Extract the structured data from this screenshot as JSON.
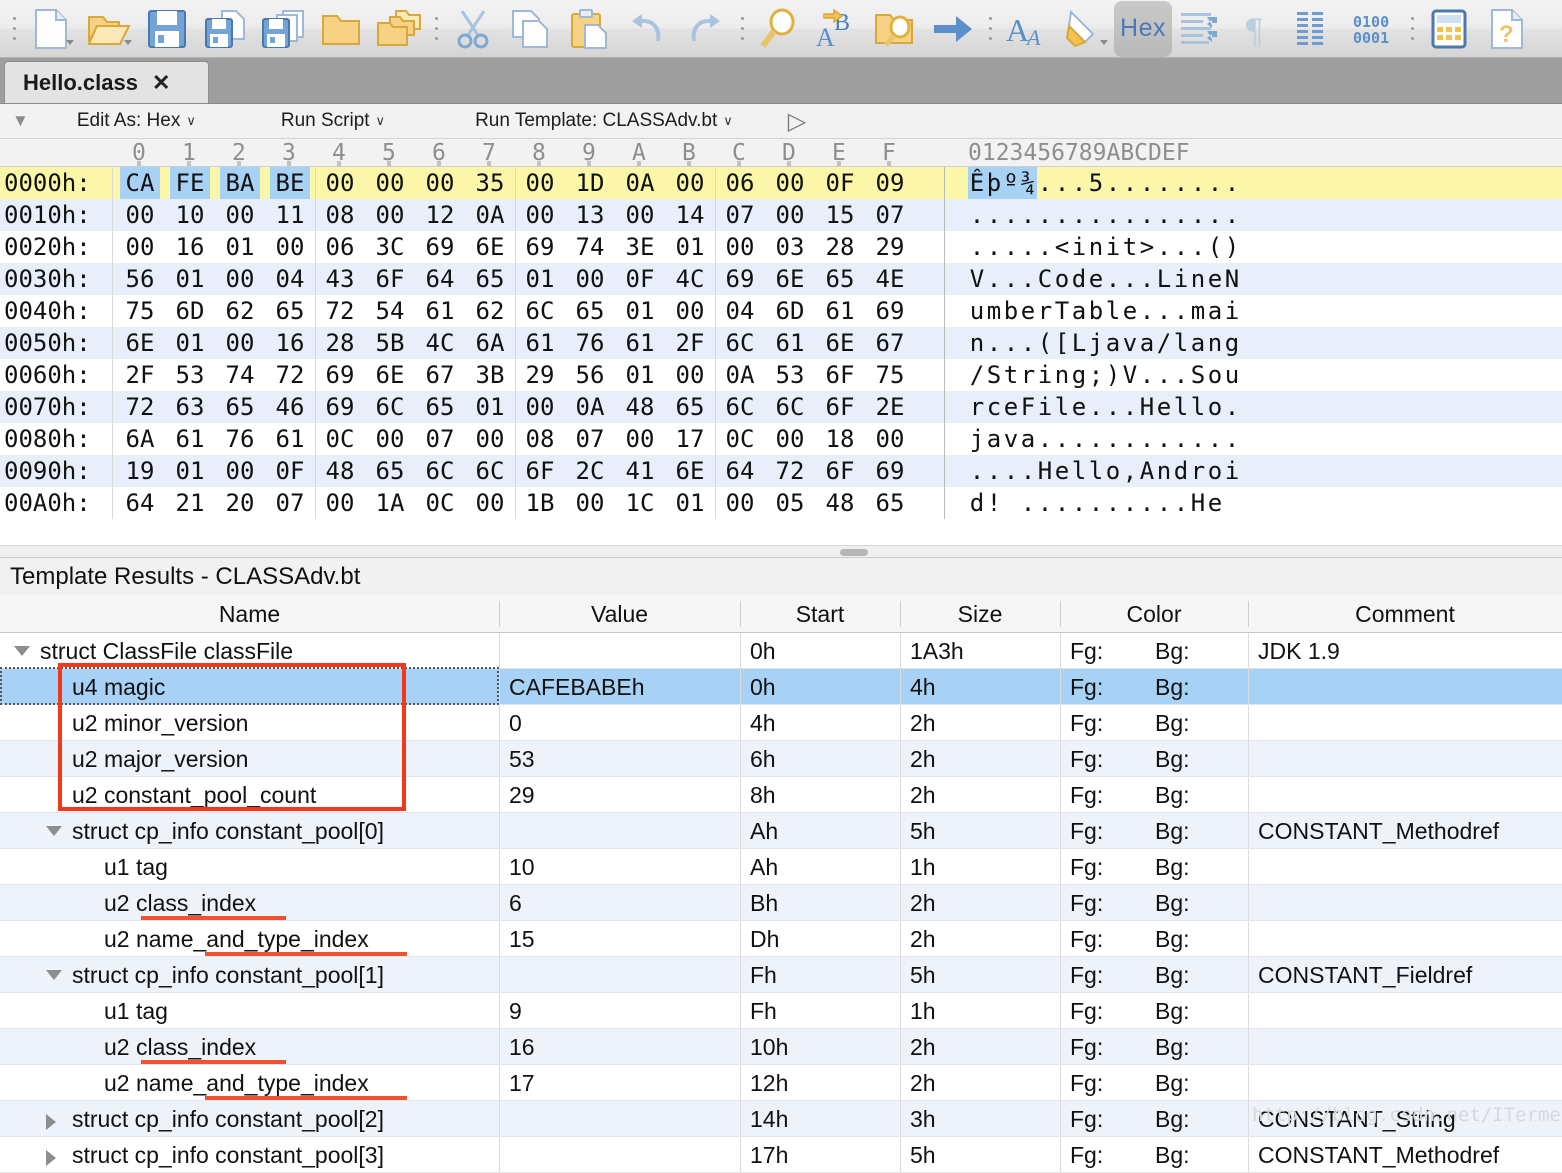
{
  "toolbar": {
    "items": [
      {
        "name": "new-file-icon",
        "label": "New"
      },
      {
        "name": "open-folder-icon",
        "label": "Open"
      },
      {
        "name": "save-icon",
        "label": "Save"
      },
      {
        "name": "save-as-icon",
        "label": "Save As"
      },
      {
        "name": "save-all-icon",
        "label": "Save All"
      },
      {
        "name": "open-directory-icon",
        "label": "Open Directory"
      },
      {
        "name": "save-all-files-icon",
        "label": "Save All Files"
      },
      {
        "name": "cut-icon",
        "label": "Cut"
      },
      {
        "name": "copy-icon",
        "label": "Copy"
      },
      {
        "name": "paste-icon",
        "label": "Paste"
      },
      {
        "name": "undo-icon",
        "label": "Undo"
      },
      {
        "name": "redo-icon",
        "label": "Redo"
      },
      {
        "name": "find-icon",
        "label": "Find"
      },
      {
        "name": "replace-icon",
        "label": "Replace"
      },
      {
        "name": "find-in-files-icon",
        "label": "Find In Files"
      },
      {
        "name": "goto-icon",
        "label": "Goto"
      },
      {
        "name": "font-icon",
        "label": "Font"
      },
      {
        "name": "highlight-icon",
        "label": "Highlight"
      },
      {
        "name": "hex-mode-button",
        "label": "Hex"
      },
      {
        "name": "wrap-lines-icon",
        "label": "Wrap Lines"
      },
      {
        "name": "show-paragraph-icon",
        "label": "Show Paragraph"
      },
      {
        "name": "line-numbers-icon",
        "label": "Line Numbers"
      },
      {
        "name": "binary-view-icon",
        "label": "Binary View"
      },
      {
        "name": "calculator-icon",
        "label": "Calculator"
      },
      {
        "name": "help-icon",
        "label": "Help"
      }
    ],
    "hex_label": "Hex"
  },
  "tab": {
    "title": "Hello.class",
    "close": "✕"
  },
  "subbar": {
    "collapse_icon": "▼",
    "edit_as": "Edit As: Hex",
    "run_script": "Run Script",
    "run_template": "Run Template: CLASSAdv.bt",
    "play": "▷",
    "chevron": "∨"
  },
  "hex": {
    "column_header": [
      "0",
      "1",
      "2",
      "3",
      "4",
      "5",
      "6",
      "7",
      "8",
      "9",
      "A",
      "B",
      "C",
      "D",
      "E",
      "F"
    ],
    "ascii_header": "0123456789ABCDEF",
    "rows": [
      {
        "addr": "0000h:",
        "bytes": [
          "CA",
          "FE",
          "BA",
          "BE",
          "00",
          "00",
          "00",
          "35",
          "00",
          "1D",
          "0A",
          "00",
          "06",
          "00",
          "0F",
          "09"
        ],
        "ascii": "Êþº¾...5........",
        "selected": true,
        "hl_start": 0,
        "hl_end": 4
      },
      {
        "addr": "0010h:",
        "bytes": [
          "00",
          "10",
          "00",
          "11",
          "08",
          "00",
          "12",
          "0A",
          "00",
          "13",
          "00",
          "14",
          "07",
          "00",
          "15",
          "07"
        ],
        "ascii": "................",
        "alt": true
      },
      {
        "addr": "0020h:",
        "bytes": [
          "00",
          "16",
          "01",
          "00",
          "06",
          "3C",
          "69",
          "6E",
          "69",
          "74",
          "3E",
          "01",
          "00",
          "03",
          "28",
          "29"
        ],
        "ascii": ".....<init>...()"
      },
      {
        "addr": "0030h:",
        "bytes": [
          "56",
          "01",
          "00",
          "04",
          "43",
          "6F",
          "64",
          "65",
          "01",
          "00",
          "0F",
          "4C",
          "69",
          "6E",
          "65",
          "4E"
        ],
        "ascii": "V...Code...LineN",
        "alt": true
      },
      {
        "addr": "0040h:",
        "bytes": [
          "75",
          "6D",
          "62",
          "65",
          "72",
          "54",
          "61",
          "62",
          "6C",
          "65",
          "01",
          "00",
          "04",
          "6D",
          "61",
          "69"
        ],
        "ascii": "umberTable...mai"
      },
      {
        "addr": "0050h:",
        "bytes": [
          "6E",
          "01",
          "00",
          "16",
          "28",
          "5B",
          "4C",
          "6A",
          "61",
          "76",
          "61",
          "2F",
          "6C",
          "61",
          "6E",
          "67"
        ],
        "ascii": "n...([Ljava/lang",
        "alt": true
      },
      {
        "addr": "0060h:",
        "bytes": [
          "2F",
          "53",
          "74",
          "72",
          "69",
          "6E",
          "67",
          "3B",
          "29",
          "56",
          "01",
          "00",
          "0A",
          "53",
          "6F",
          "75"
        ],
        "ascii": "/String;)V...Sou"
      },
      {
        "addr": "0070h:",
        "bytes": [
          "72",
          "63",
          "65",
          "46",
          "69",
          "6C",
          "65",
          "01",
          "00",
          "0A",
          "48",
          "65",
          "6C",
          "6C",
          "6F",
          "2E"
        ],
        "ascii": "rceFile...Hello.",
        "alt": true
      },
      {
        "addr": "0080h:",
        "bytes": [
          "6A",
          "61",
          "76",
          "61",
          "0C",
          "00",
          "07",
          "00",
          "08",
          "07",
          "00",
          "17",
          "0C",
          "00",
          "18",
          "00"
        ],
        "ascii": "java............"
      },
      {
        "addr": "0090h:",
        "bytes": [
          "19",
          "01",
          "00",
          "0F",
          "48",
          "65",
          "6C",
          "6C",
          "6F",
          "2C",
          "41",
          "6E",
          "64",
          "72",
          "6F",
          "69"
        ],
        "ascii": "....Hello,Androi",
        "alt": true
      },
      {
        "addr": "00A0h:",
        "bytes": [
          "64",
          "21",
          "20",
          "07",
          "00",
          "1A",
          "0C",
          "00",
          "1B",
          "00",
          "1C",
          "01",
          "00",
          "05",
          "48",
          "65"
        ],
        "ascii": "d! ..........He"
      }
    ]
  },
  "template_results": {
    "title": "Template Results - CLASSAdv.bt",
    "columns": [
      "Name",
      "Value",
      "Start",
      "Size",
      "Color",
      "Comment"
    ],
    "color_fg_label": "Fg:",
    "color_bg_label": "Bg:",
    "rows": [
      {
        "indent": 0,
        "twisty": "down",
        "name": "struct ClassFile classFile",
        "value": "",
        "start": "0h",
        "size": "1A3h",
        "comment": "JDK 1.9",
        "alt": false
      },
      {
        "indent": 1,
        "twisty": "none",
        "name": "u4 magic",
        "value": "CAFEBABEh",
        "start": "0h",
        "size": "4h",
        "comment": "",
        "selected": true
      },
      {
        "indent": 1,
        "twisty": "none",
        "name": "u2 minor_version",
        "value": "0",
        "start": "4h",
        "size": "2h",
        "comment": "",
        "alt": false
      },
      {
        "indent": 1,
        "twisty": "none",
        "name": "u2 major_version",
        "value": "53",
        "start": "6h",
        "size": "2h",
        "comment": "",
        "alt": true
      },
      {
        "indent": 1,
        "twisty": "none",
        "name": "u2 constant_pool_count",
        "value": "29",
        "start": "8h",
        "size": "2h",
        "comment": "",
        "alt": false
      },
      {
        "indent": 1,
        "twisty": "down",
        "name": "struct cp_info constant_pool[0]",
        "value": "",
        "start": "Ah",
        "size": "5h",
        "comment": "CONSTANT_Methodref",
        "alt": true
      },
      {
        "indent": 2,
        "twisty": "none",
        "name": "u1 tag",
        "value": "10",
        "start": "Ah",
        "size": "1h",
        "comment": "",
        "alt": false
      },
      {
        "indent": 2,
        "twisty": "none",
        "name": "u2 class_index",
        "value": "6",
        "start": "Bh",
        "size": "2h",
        "comment": "",
        "alt": true
      },
      {
        "indent": 2,
        "twisty": "none",
        "name": "u2 name_and_type_index",
        "value": "15",
        "start": "Dh",
        "size": "2h",
        "comment": "",
        "alt": false
      },
      {
        "indent": 1,
        "twisty": "down",
        "name": "struct cp_info constant_pool[1]",
        "value": "",
        "start": "Fh",
        "size": "5h",
        "comment": "CONSTANT_Fieldref",
        "alt": true
      },
      {
        "indent": 2,
        "twisty": "none",
        "name": "u1 tag",
        "value": "9",
        "start": "Fh",
        "size": "1h",
        "comment": "",
        "alt": false
      },
      {
        "indent": 2,
        "twisty": "none",
        "name": "u2 class_index",
        "value": "16",
        "start": "10h",
        "size": "2h",
        "comment": "",
        "alt": true
      },
      {
        "indent": 2,
        "twisty": "none",
        "name": "u2 name_and_type_index",
        "value": "17",
        "start": "12h",
        "size": "2h",
        "comment": "",
        "alt": false
      },
      {
        "indent": 1,
        "twisty": "right",
        "name": "struct cp_info constant_pool[2]",
        "value": "",
        "start": "14h",
        "size": "3h",
        "comment": "CONSTANT_String",
        "alt": true
      },
      {
        "indent": 1,
        "twisty": "right",
        "name": "struct cp_info constant_pool[3]",
        "value": "",
        "start": "17h",
        "size": "5h",
        "comment": "CONSTANT_Methodref",
        "alt": false
      }
    ]
  },
  "annotations": {
    "watermark": "http://blog.csdn.net/ITermeng",
    "box_color": "#f03a20",
    "underline_color": "#f0512e"
  }
}
